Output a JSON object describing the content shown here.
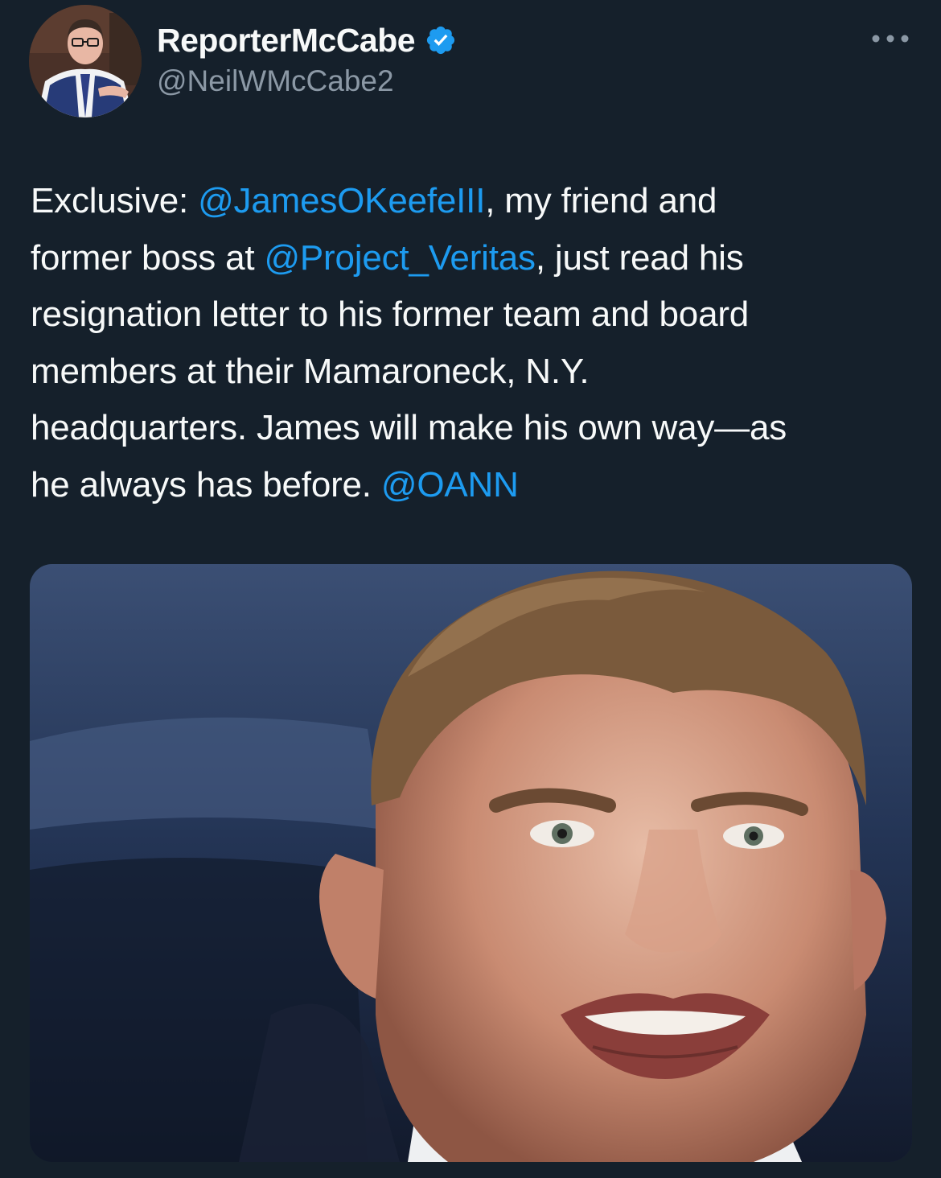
{
  "app": {
    "theme_colors": {
      "background": "#15202b",
      "text_primary": "#f7f9f9",
      "text_secondary": "#8b98a5",
      "accent_link": "#1d9bf0",
      "verified_badge": "#1d9bf0"
    }
  },
  "author": {
    "display_name": "ReporterMcCabe",
    "handle": "@NeilWMcCabe2",
    "verified": true,
    "verified_icon": "verified-badge-icon",
    "avatar_icon": "profile-photo"
  },
  "toolbar": {
    "more_icon": "more-horizontal-icon"
  },
  "tweet": {
    "lines": [
      [
        {
          "text": "Exclusive: ",
          "mention": false
        },
        {
          "text": "@JamesOKeefeIII",
          "mention": true
        },
        {
          "text": ", my friend and",
          "mention": false
        }
      ],
      [
        {
          "text": "former boss at ",
          "mention": false
        },
        {
          "text": "@Project_Veritas",
          "mention": true
        },
        {
          "text": ", just read his",
          "mention": false
        }
      ],
      [
        {
          "text": "resignation letter to his former team and board",
          "mention": false
        }
      ],
      [
        {
          "text": "members at their Mamaroneck, N.Y.",
          "mention": false
        }
      ],
      [
        {
          "text": "headquarters. James will make his own way—as",
          "mention": false
        }
      ],
      [
        {
          "text": "he always has before. ",
          "mention": false
        },
        {
          "text": "@OANN",
          "mention": true
        }
      ]
    ]
  },
  "media": {
    "kind": "photo",
    "subject": "close-up photo of a man speaking"
  }
}
